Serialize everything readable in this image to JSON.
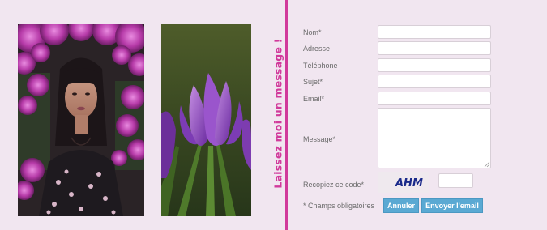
{
  "form": {
    "title": "Laissez moi un message !",
    "fields": [
      {
        "label": "Nom*",
        "value": ""
      },
      {
        "label": "Adresse",
        "value": ""
      },
      {
        "label": "Téléphone",
        "value": ""
      },
      {
        "label": "Sujet*",
        "value": ""
      },
      {
        "label": "Email*",
        "value": ""
      }
    ],
    "message": {
      "label": "Message*",
      "value": ""
    },
    "captcha": {
      "label": "Recopiez ce code*",
      "code": "AHM",
      "value": ""
    },
    "required_note": "* Champs obligatoires",
    "buttons": {
      "cancel": "Annuler",
      "send": "Envoyer l'email"
    }
  },
  "colors": {
    "background": "#f1e6f0",
    "accent": "#d13a9b",
    "button": "#5aa9d3",
    "captcha_text": "#1a2a8a"
  },
  "images": [
    {
      "name": "woman-with-pink-flowers-photo"
    },
    {
      "name": "purple-crocus-photo"
    }
  ]
}
